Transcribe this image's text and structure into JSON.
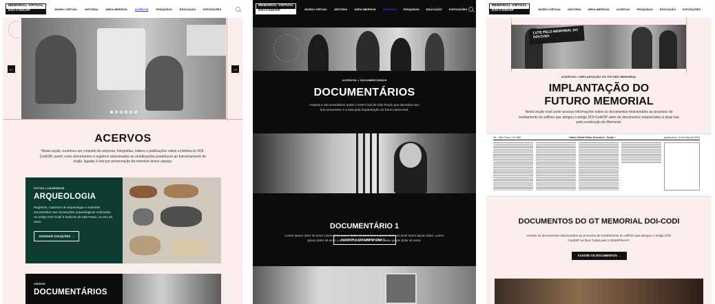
{
  "nav": {
    "logo_line1": "MEMORIAL VIRTUAL",
    "logo_line2": "DOI-CODI/SP",
    "items": [
      "MUSEU VIRTUAL",
      "HISTÓRIA",
      "ÁREA IMERSIVA",
      "ACERVOS",
      "PESQUISAS",
      "EDUCAÇÃO",
      "EXPOSIÇÕES"
    ],
    "active": "ACERVOS"
  },
  "acervos_page": {
    "title": "ACERVOS",
    "description": "Nesta seção, reunimos um conjunto de arquivos, fotografias, vídeos e publicações sobre a história do DOI-Codi/SP, assim como documentos e registros relacionados às mobilizações posteriores ao funcionamento do órgão, ligadas à luta por preservação da memória desse espaço.",
    "carousel_slides": 6,
    "carousel_active": 1,
    "cards": [
      {
        "kicker": "FOTOS | CADERNOS",
        "title": "ARQUEOLOGIA",
        "text": "Registros, cadernos de arqueologia e materiais encontrados nas escavações arqueológicas realizadas no antigo DOI-Codi/ II Exército de São Paulo, no ano de 2023.",
        "button": "ACESSAR COLEÇÕES",
        "color": "#0e3b2f"
      },
      {
        "kicker": "VÍDEOS",
        "title": "DOCUMENTÁRIOS"
      }
    ]
  },
  "documentarios_page": {
    "breadcrumb": "ACERVOS  >  DOCUMENTÁRIOS",
    "title": "DOCUMENTÁRIOS",
    "description": "Assista a documentários sobre o DOI-Codi de São Paulo que abordam seu funcionamento e a luta pela implantação do futuro Memorial.",
    "item_title": "DOCUMENTÁRIO 1",
    "item_text": "Lorem ipsum dolor sit amet consectetur ipsum dolor sit amet lorem ipsum dolor sit amet lorem ipsum dolor. Lorem ipsum dolor sit amet consectetur ipsum dolor sit amet lorem ipsum dolor sit amet.",
    "item_button": "ASSISTIR A DOCUMENTÁRIO 1"
  },
  "implantacao_page": {
    "hero_banner": "LUTE PELO MEMORIAL DO DOI-CODI",
    "breadcrumb": "ACERVOS  >  IMPLANTAÇÃO DO FUTURO MEMORIAL",
    "title_line1": "IMPLANTAÇÃO DO",
    "title_line2": "FUTURO MEMORIAL",
    "description": "Nesta seção você pode acessar informações sobre os documentos relacionados ao processo de tombamento do edifício que abrigou o antigo DOI-Codi/SP além de documentos relacionados à atual luta pela construção do Memorial.",
    "newspaper_left": "28 – São Paulo, 124 (88)",
    "newspaper_center": "Diário Oficial Poder Executivo - Seção I",
    "newspaper_right": "quarta-feira, 14 de maio de 2014",
    "section_title": "DOCUMENTOS DO GT MEMORIAL DOI-CODI",
    "section_text": "Acesse os documentos relacionados ao processo de tombamento do edifício que abrigou o antigo DOI-Codi/SP na Rua Tutóia pelo CONDEPHAAT.",
    "section_button": "ACESSE OS DOCUMENTOS"
  }
}
